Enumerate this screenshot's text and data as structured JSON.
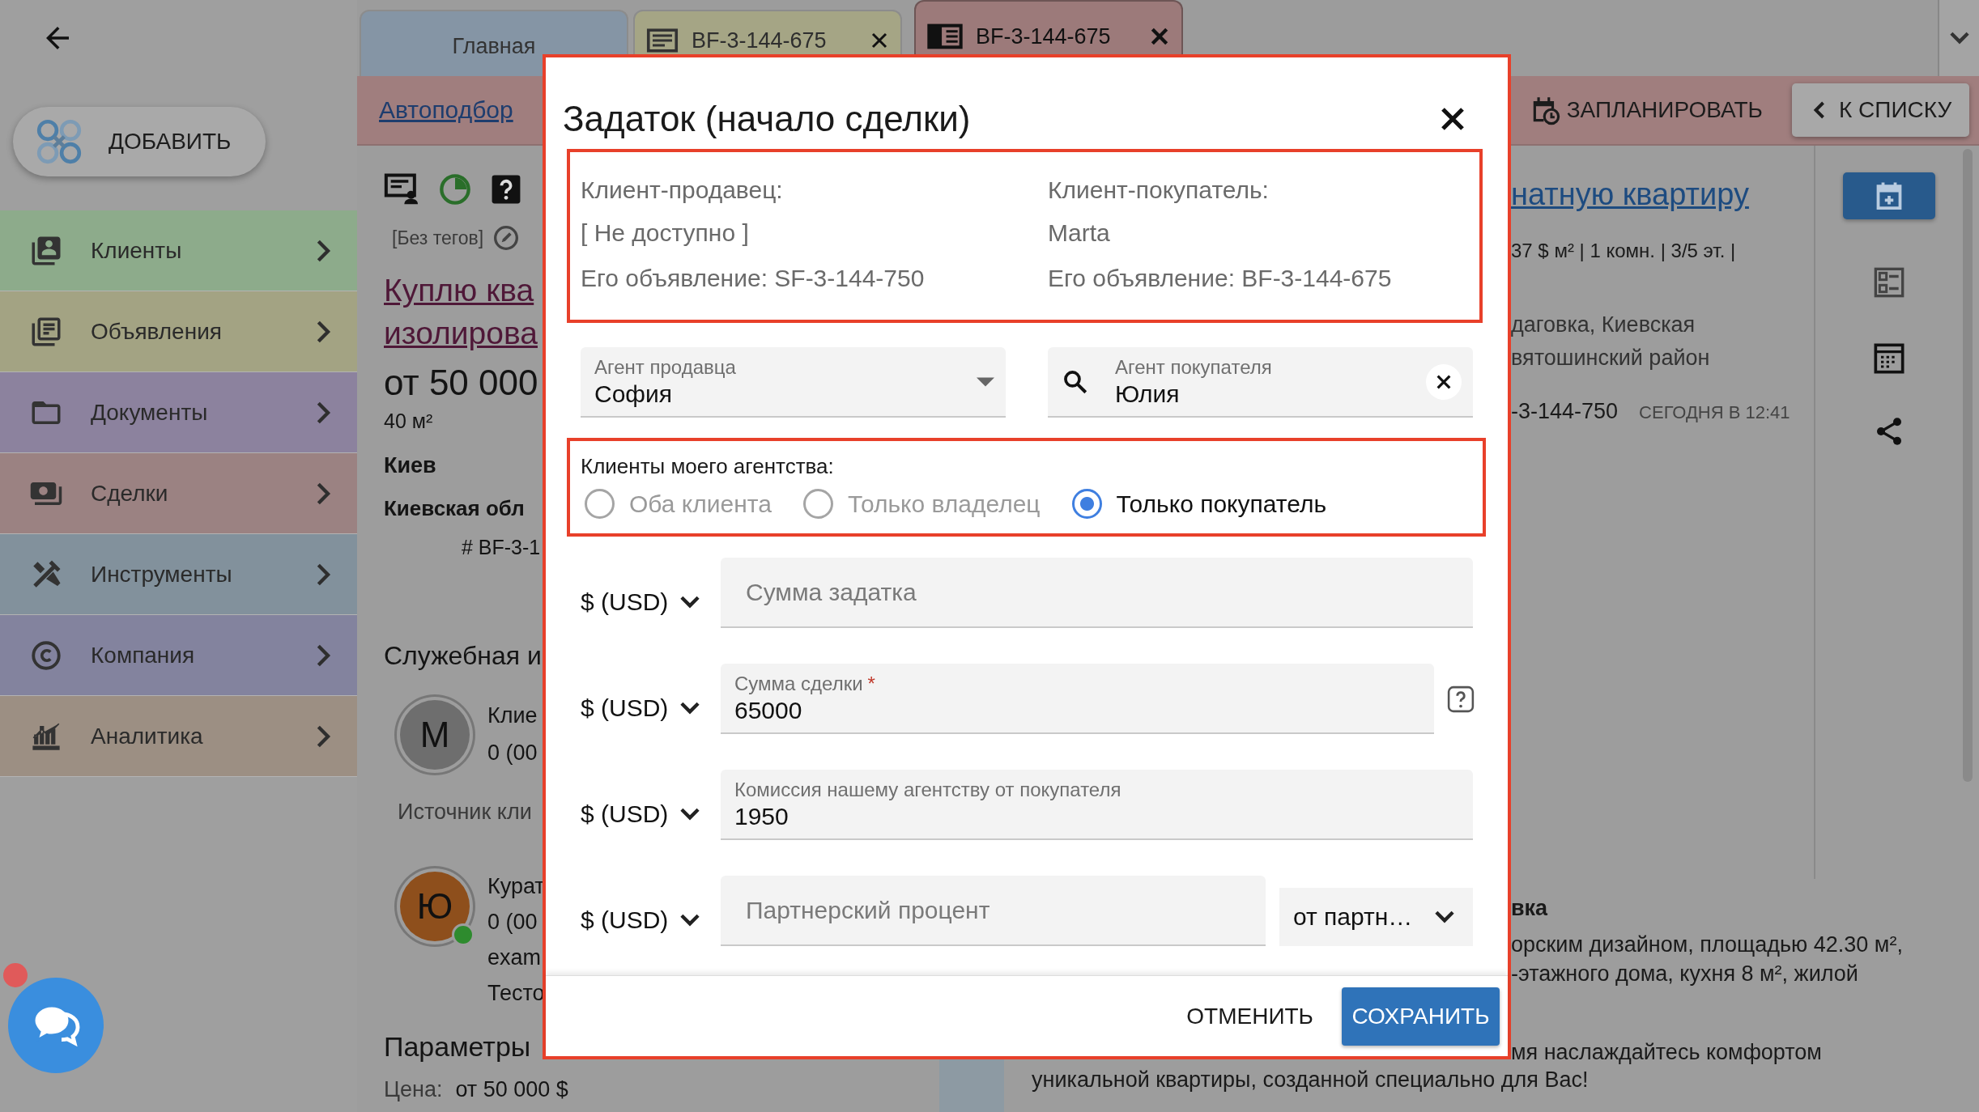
{
  "sidebar": {
    "add_button": "ДОБАВИТЬ",
    "items": [
      {
        "label": "Клиенты",
        "color": "#8dab8b"
      },
      {
        "label": "Объявления",
        "color": "#a3a383"
      },
      {
        "label": "Документы",
        "color": "#8c829e"
      },
      {
        "label": "Сделки",
        "color": "#9b8282"
      },
      {
        "label": "Инструменты",
        "color": "#82919c"
      },
      {
        "label": "Компания",
        "color": "#83839e"
      },
      {
        "label": "Аналитика",
        "color": "#9c8f83"
      }
    ]
  },
  "chat": {
    "unread": true
  },
  "tabs": [
    {
      "label": "Главная",
      "kind": "home",
      "closable": false,
      "selected": false,
      "color": "#8595a5"
    },
    {
      "label": "BF-3-144-675",
      "kind": "listing",
      "closable": true,
      "selected": false,
      "color": "#a5a585"
    },
    {
      "label": "BF-3-144-675",
      "kind": "record",
      "closable": true,
      "selected": true,
      "color": "#9c7a7a"
    }
  ],
  "toolbar": {
    "link": "Автоподбор",
    "schedule_button": "ЗАПЛАНИРОВАТЬ",
    "back_button": "К СПИСКУ"
  },
  "listing": {
    "tags": "[Без тегов]",
    "title_lines": [
      "Куплю ква",
      "изолирова"
    ],
    "price": "от 50 000",
    "area": "40 м²",
    "city": "Киев",
    "region": "Киевская обл",
    "code": "# BF-3-1",
    "service_heading": "Служебная и",
    "contacts": [
      {
        "initial": "М",
        "color": "#6e6e6e",
        "online": false,
        "lines": [
          "Клие",
          "0 (00"
        ],
        "note": "Источник кли"
      },
      {
        "initial": "Ю",
        "color": "#8e4f1c",
        "online": true,
        "lines": [
          "Курат",
          "0 (00",
          "exam",
          "Тесто"
        ]
      }
    ],
    "params_heading": "Параметры",
    "price_label": "Цена:",
    "price_value": "от 50 000 $"
  },
  "details": {
    "title_tail": "натную квартиру",
    "specs": "37 $ м² | 1 комн. | 3/5 эт. |",
    "address_lines": [
      "даговка, Киевская",
      "вятошинский район"
    ],
    "code_tail": "-3-144-750",
    "date": "СЕГОДНЯ В 12:41",
    "description": {
      "heading": "вка",
      "lines": [
        "орским дизайном, площадью 42.30 м²,",
        "-этажного дома, кухня 8 м², жилой",
        "мя наслаждайтесь комфортом"
      ],
      "last_line": "уникальной квартиры, созданной специально для Вас!"
    }
  },
  "dialog": {
    "title": "Задаток (начало сделки)",
    "seller": {
      "label": "Клиент-продавец:",
      "name": "[ Не доступно ]",
      "listing": "Его объявление: SF-3-144-750"
    },
    "buyer": {
      "label": "Клиент-покупатель:",
      "name": "Marta",
      "listing": "Его объявление: BF-3-144-675"
    },
    "seller_agent": {
      "label": "Агент продавца",
      "value": "София"
    },
    "buyer_agent": {
      "label": "Агент покупателя",
      "value": "Юлия"
    },
    "agency_clients": {
      "label": "Клиенты моего агентства:",
      "options": [
        {
          "label": "Оба клиента",
          "selected": false
        },
        {
          "label": "Только владелец",
          "selected": false
        },
        {
          "label": "Только покупатель",
          "selected": true
        }
      ]
    },
    "amounts": [
      {
        "currency": "$ (USD)",
        "placeholder": "Сумма задатка"
      },
      {
        "currency": "$ (USD)",
        "label": "Сумма сделки",
        "required_mark": "*",
        "value": "65000",
        "help": true
      },
      {
        "currency": "$ (USD)",
        "label": "Комиссия нашему агентству от покупателя",
        "value": "1950"
      },
      {
        "currency": "$ (USD)",
        "placeholder": "Партнерский процент",
        "select": "от партн…"
      }
    ],
    "cancel_button": "ОТМЕНИТЬ",
    "save_button": "СОХРАНИТЬ"
  }
}
